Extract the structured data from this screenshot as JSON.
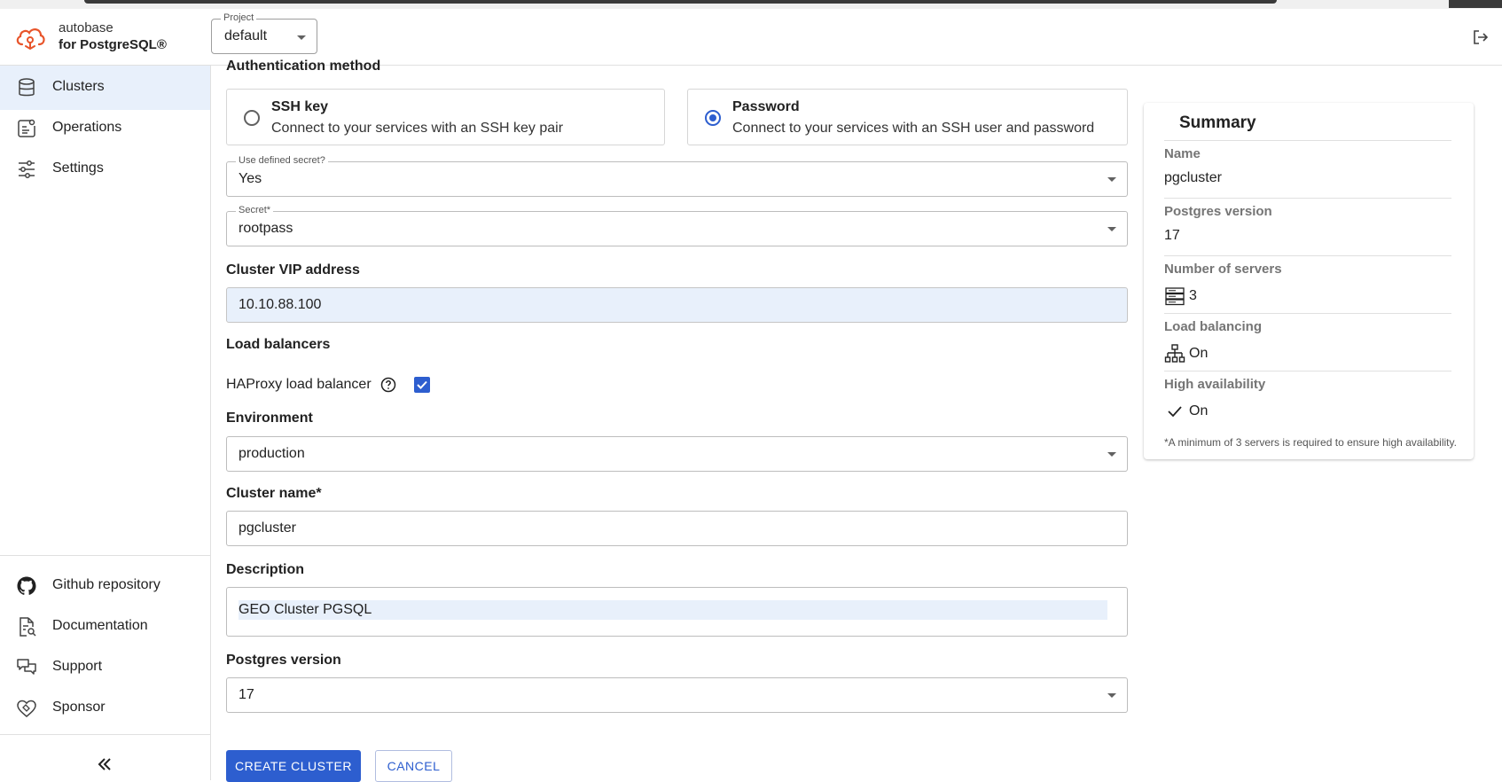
{
  "app": {
    "brand_line1": "autobase",
    "brand_line2": "for PostgreSQL®",
    "project_label": "Project",
    "project_value": "default"
  },
  "sidebar": {
    "items": [
      {
        "label": "Clusters",
        "icon": "database-icon",
        "active": true
      },
      {
        "label": "Operations",
        "icon": "operations-icon"
      },
      {
        "label": "Settings",
        "icon": "settings-sliders-icon"
      }
    ],
    "footer_items": [
      {
        "label": "Github repository",
        "icon": "github-icon"
      },
      {
        "label": "Documentation",
        "icon": "documentation-icon"
      },
      {
        "label": "Support",
        "icon": "support-chat-icon"
      },
      {
        "label": "Sponsor",
        "icon": "sponsor-handshake-icon"
      }
    ]
  },
  "form": {
    "auth_method_label": "Authentication method",
    "auth_options": [
      {
        "title": "SSH key",
        "desc": "Connect to your services with an SSH key pair",
        "selected": false
      },
      {
        "title": "Password",
        "desc": "Connect to your services with an SSH user and password",
        "selected": true
      }
    ],
    "use_defined_secret": {
      "label": "Use defined secret?",
      "value": "Yes"
    },
    "secret": {
      "label": "Secret*",
      "value": "rootpass"
    },
    "cluster_vip_label": "Cluster VIP address",
    "cluster_vip_value": "10.10.88.100",
    "load_balancers_label": "Load balancers",
    "haproxy_label": "HAProxy load balancer",
    "haproxy_checked": true,
    "environment_label": "Environment",
    "environment_value": "production",
    "cluster_name_label": "Cluster name*",
    "cluster_name_value": "pgcluster",
    "description_label": "Description",
    "description_value": "GEO Cluster PGSQL",
    "postgres_version_label": "Postgres version",
    "postgres_version_value": "17",
    "create_button": "CREATE CLUSTER",
    "cancel_button": "CANCEL"
  },
  "summary": {
    "title": "Summary",
    "rows": [
      {
        "label": "Name",
        "value": "pgcluster"
      },
      {
        "label": "Postgres version",
        "value": "17"
      },
      {
        "label": "Number of servers",
        "value": "3",
        "icon": "servers-icon"
      },
      {
        "label": "Load balancing",
        "value": "On",
        "icon": "network-hierarchy-icon"
      },
      {
        "label": "High availability",
        "value": "On",
        "icon": "check-icon"
      }
    ],
    "note": "*A minimum of 3 servers is required to ensure high availability."
  },
  "colors": {
    "accent": "#2d5ecf",
    "active_bg": "#e8f0fb",
    "logo": "#e8542a"
  }
}
